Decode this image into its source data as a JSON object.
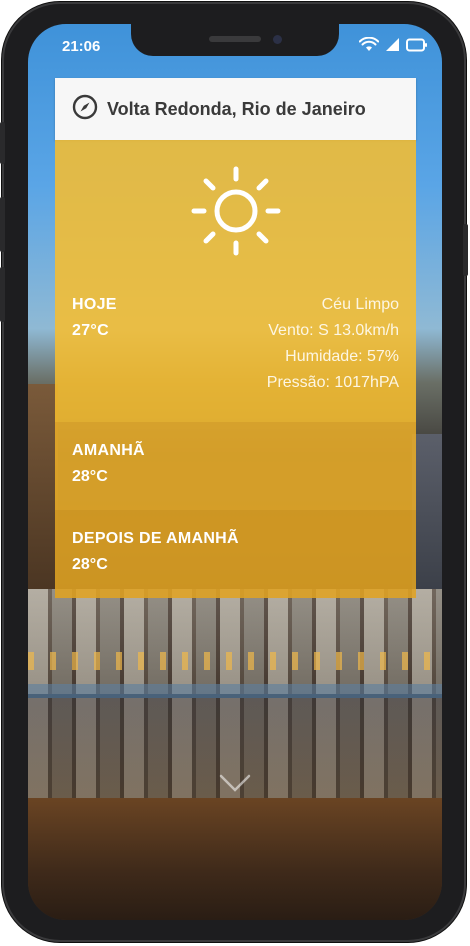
{
  "status_bar": {
    "time": "21:06",
    "icons": [
      "wifi-icon",
      "cellular-signal-icon",
      "battery-icon"
    ]
  },
  "location": {
    "icon": "compass-icon",
    "name": "Volta Redonda, Rio de Janeiro"
  },
  "today": {
    "icon": "sun-icon",
    "day_label": "HOJE",
    "temperature": "27°C",
    "condition": "Céu Limpo",
    "wind": "Vento: S 13.0km/h",
    "humidity": "Humidade: 57%",
    "pressure": "Pressão: 1017hPA"
  },
  "forecast": [
    {
      "day_label": "AMANHÃ",
      "temperature": "28°C"
    },
    {
      "day_label": "DEPOIS DE AMANHÃ",
      "temperature": "28°C"
    }
  ],
  "colors": {
    "card_today": "#F8BE2D",
    "card_tomorrow": "#ECAF28",
    "card_after": "#E0A322",
    "location_bar": "#F7F7F7",
    "text_light": "#FFFFFF"
  }
}
